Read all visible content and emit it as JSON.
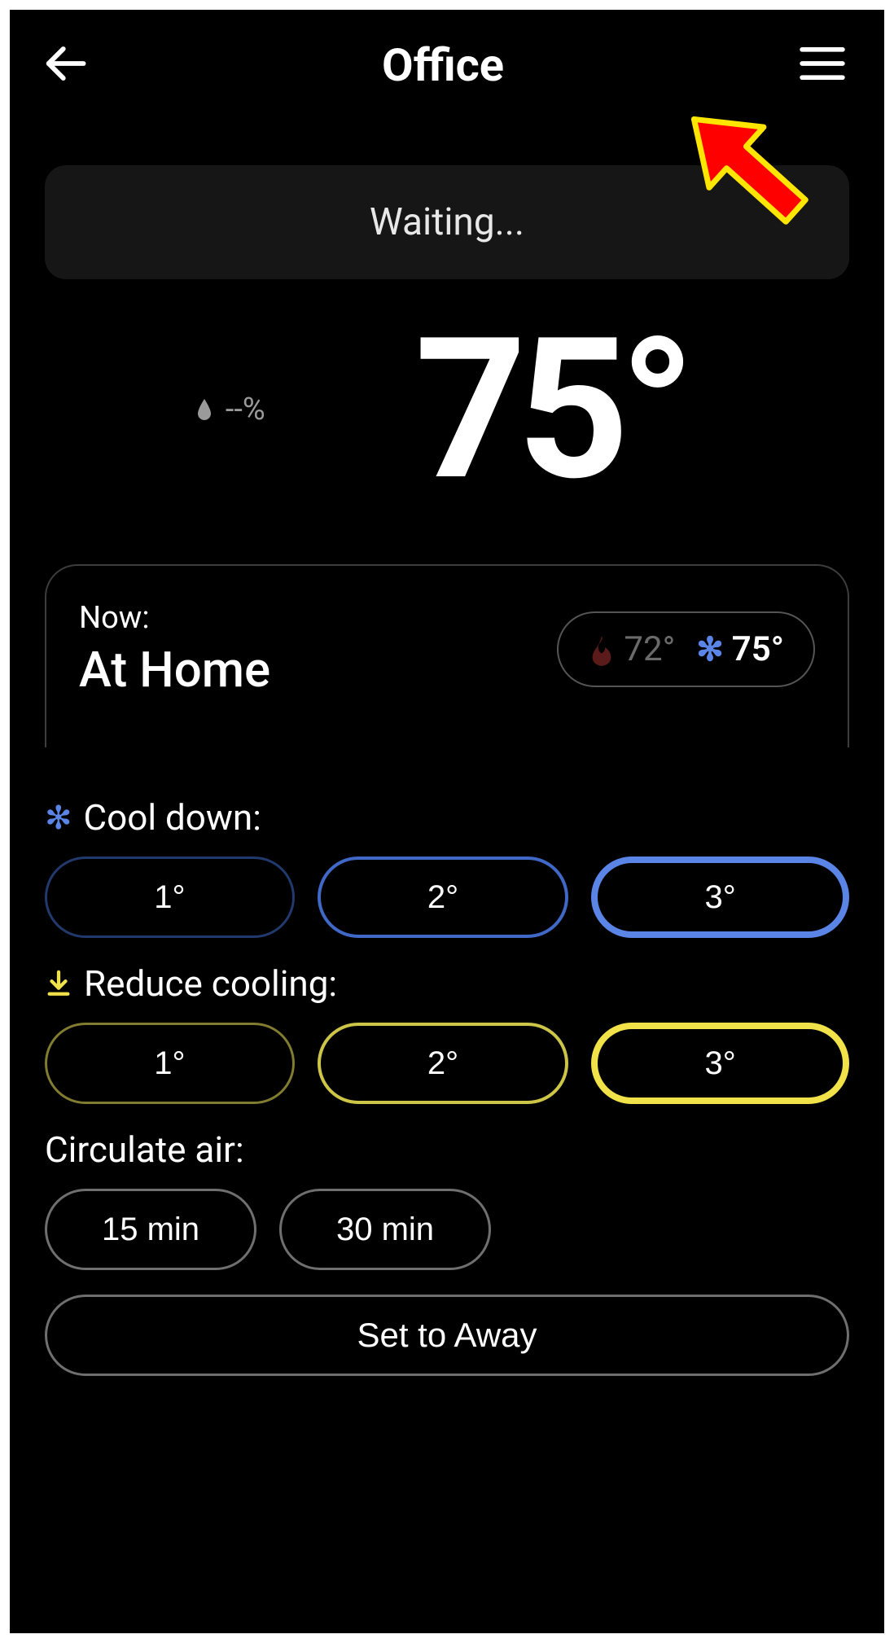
{
  "header": {
    "title": "Office"
  },
  "status": {
    "text": "Waiting..."
  },
  "readout": {
    "humidity": "--%",
    "temp": "75°"
  },
  "schedule": {
    "now_label": "Now:",
    "name": "At Home",
    "heat_sp": "72°",
    "cool_sp": "75°"
  },
  "cool_down": {
    "label": "Cool down:",
    "options": [
      "1°",
      "2°",
      "3°"
    ]
  },
  "reduce_cooling": {
    "label": "Reduce cooling:",
    "options": [
      "1°",
      "2°",
      "3°"
    ]
  },
  "circulate": {
    "label": "Circulate air:",
    "options": [
      "15 min",
      "30 min"
    ]
  },
  "away": {
    "label": "Set to Away"
  }
}
